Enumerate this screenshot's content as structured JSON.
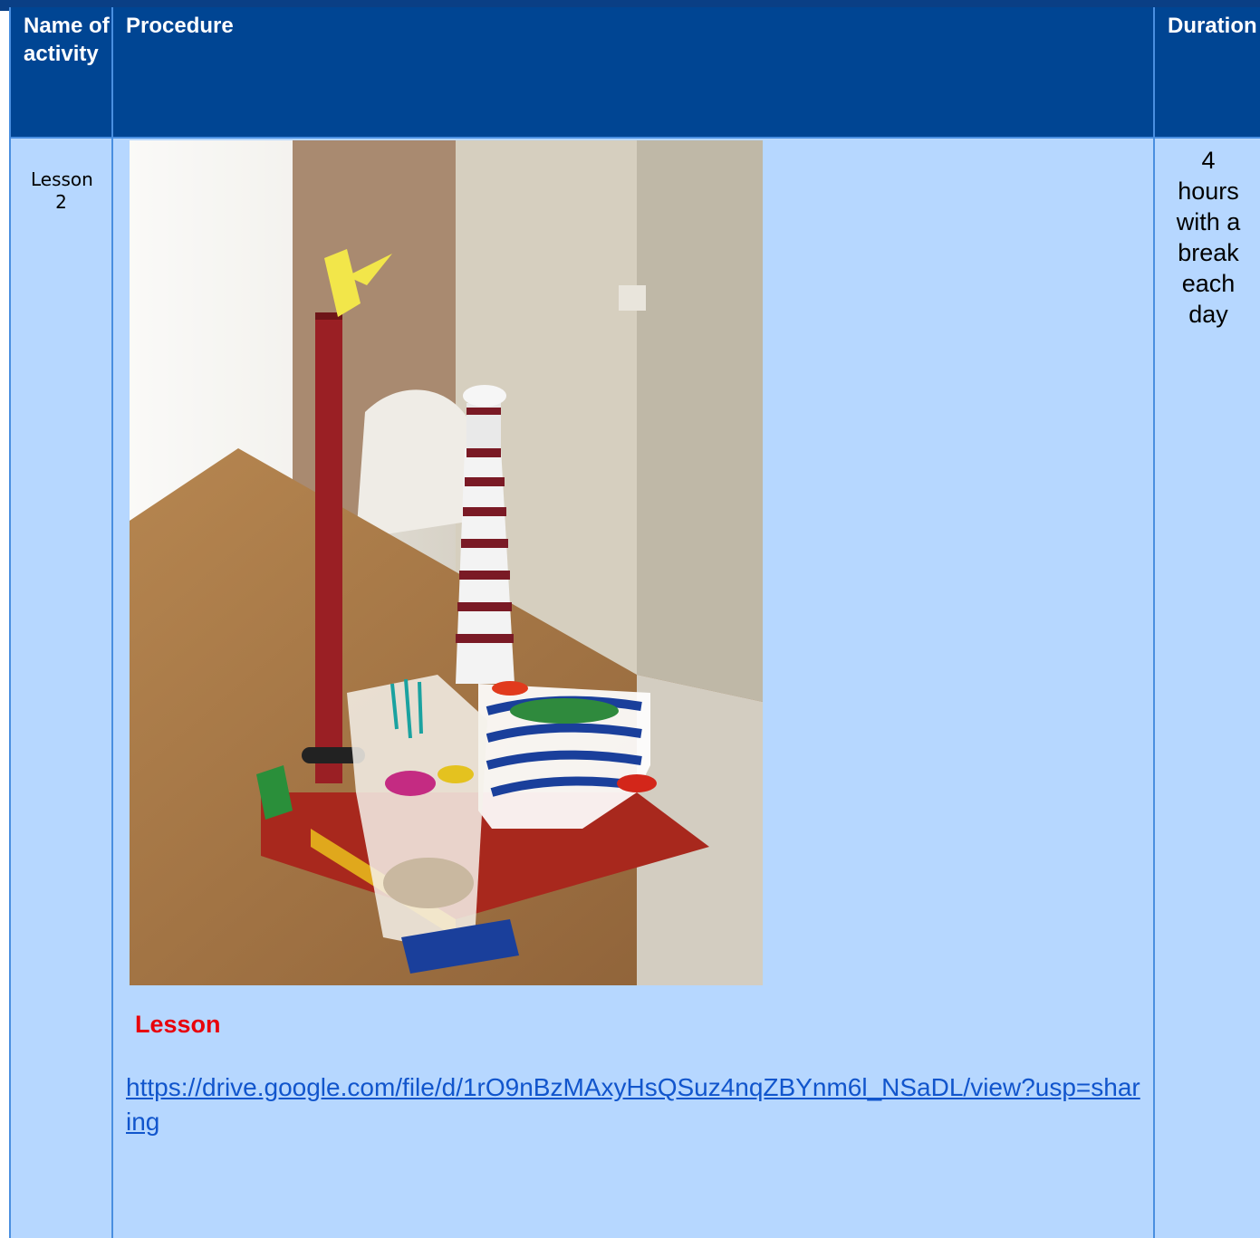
{
  "header": {
    "col_name": "Name of activity",
    "col_procedure": "Procedure",
    "col_duration": "Duration"
  },
  "row": {
    "name": "Lesson 2",
    "procedure_title": "Lesson",
    "link": "https://drive.google.com/file/d/1rO9nBzMAxyHsQSuz4nqZBYnm6l_NSaDL/view?usp=sharing",
    "duration": "4 hours with a break each day"
  },
  "colors": {
    "header_bg": "#004593",
    "body_bg": "#b6d7ff",
    "border": "#4a8fe0",
    "lesson_title": "#e8000a",
    "link": "#1155cc"
  }
}
